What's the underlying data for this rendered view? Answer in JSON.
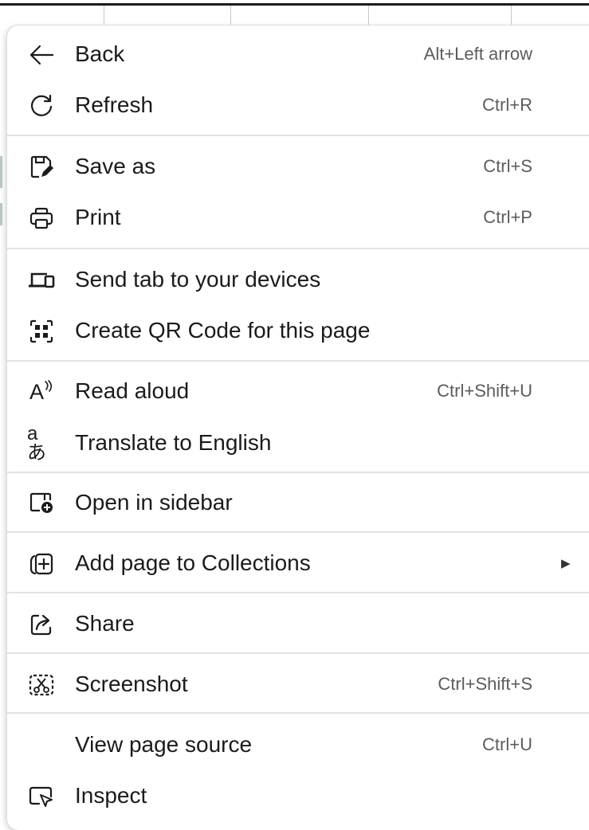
{
  "menu": {
    "items": [
      {
        "label": "Back",
        "shortcut": "Alt+Left arrow",
        "icon": "arrow-left-icon"
      },
      {
        "label": "Refresh",
        "shortcut": "Ctrl+R",
        "icon": "refresh-icon"
      },
      {
        "label": "Save as",
        "shortcut": "Ctrl+S",
        "icon": "save-as-icon"
      },
      {
        "label": "Print",
        "shortcut": "Ctrl+P",
        "icon": "printer-icon"
      },
      {
        "label": "Send tab to your devices",
        "shortcut": "",
        "icon": "devices-icon"
      },
      {
        "label": "Create QR Code for this page",
        "shortcut": "",
        "icon": "qr-code-icon"
      },
      {
        "label": "Read aloud",
        "shortcut": "Ctrl+Shift+U",
        "icon": "read-aloud-icon",
        "icon_text": "A"
      },
      {
        "label": "Translate to English",
        "shortcut": "",
        "icon": "translate-icon",
        "icon_text": "aあ"
      },
      {
        "label": "Open in sidebar",
        "shortcut": "",
        "icon": "sidebar-icon"
      },
      {
        "label": "Add page to Collections",
        "shortcut": "",
        "icon": "collections-add-icon",
        "submenu": true,
        "submenu_icon": "▶"
      },
      {
        "label": "Share",
        "shortcut": "",
        "icon": "share-icon"
      },
      {
        "label": "Screenshot",
        "shortcut": "Ctrl+Shift+S",
        "icon": "screenshot-icon"
      },
      {
        "label": "View page source",
        "shortcut": "Ctrl+U",
        "icon": ""
      },
      {
        "label": "Inspect",
        "shortcut": "",
        "icon": "inspect-icon"
      }
    ]
  }
}
